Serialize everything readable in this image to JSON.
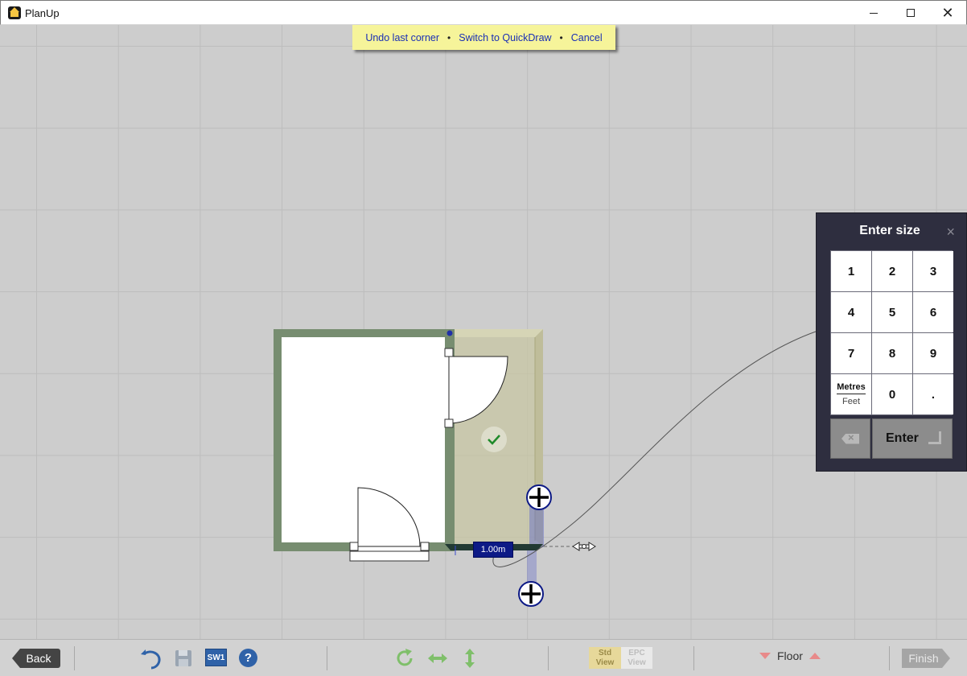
{
  "window": {
    "title": "PlanUp"
  },
  "hint_bar": {
    "undo_label": "Undo last corner",
    "quickdraw_label": "Switch to QuickDraw",
    "cancel_label": "Cancel",
    "separator": "•"
  },
  "drawing": {
    "dimension_label": "1.00m"
  },
  "size_panel": {
    "title": "Enter size",
    "close": "×",
    "keys": [
      "1",
      "2",
      "3",
      "4",
      "5",
      "6",
      "7",
      "8",
      "9"
    ],
    "unit_primary": "Metres",
    "unit_secondary": "Feet",
    "zero": "0",
    "decimal": ".",
    "enter_label": "Enter"
  },
  "toolbar": {
    "back_label": "Back",
    "sw1_label": "SW1",
    "help_label": "?",
    "std_view_line1": "Std",
    "std_view_line2": "View",
    "epc_view_line1": "EPC",
    "epc_view_line2": "View",
    "floor_label": "Floor",
    "finish_label": "Finish"
  },
  "colors": {
    "wall": "#778d70",
    "new_room_fill": "#c7c6a3",
    "dimension_bg": "#0d1a86",
    "hint_bg": "#f6f49a",
    "panel_bg": "#2e2e3f"
  }
}
